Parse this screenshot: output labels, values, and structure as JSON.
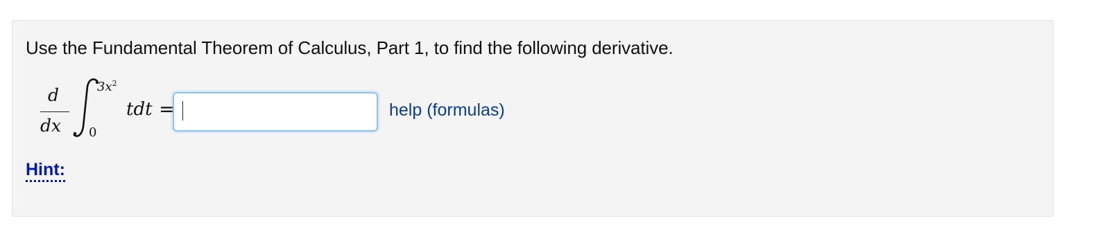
{
  "problem": {
    "prompt": "Use the Fundamental Theorem of Calculus, Part 1, to find the following derivative.",
    "math": {
      "derivative_numerator": "d",
      "derivative_denominator": "dx",
      "integral_symbol": "∫",
      "upper_limit_base": "3x",
      "upper_limit_exponent": "2",
      "lower_limit": "0",
      "integrand": "tdt",
      "equals": "="
    },
    "answer": {
      "value": "",
      "placeholder": ""
    },
    "help_link": "help (formulas)",
    "hint": "Hint:"
  },
  "colors": {
    "panel_background": "#f4f4f4",
    "link": "#0b3d91",
    "hint": "#0019a8",
    "input_focus_border": "#8fc4ee"
  }
}
